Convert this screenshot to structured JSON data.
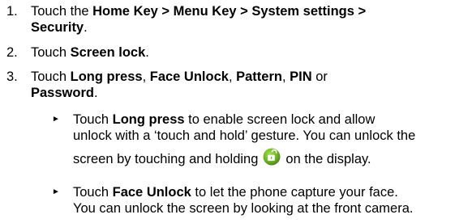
{
  "steps": [
    {
      "number": "1.",
      "lines": [
        {
          "pre": "Touch the ",
          "bold": "Home Key > Menu Key > System settings >"
        },
        {
          "bold": "Security",
          "post": "."
        }
      ]
    },
    {
      "number": "2.",
      "pre": "Touch ",
      "bold": "Screen lock",
      "post": "."
    },
    {
      "number": "3.",
      "line1": {
        "pre": "Touch ",
        "b1": "Long press",
        "s1": ", ",
        "b2": "Face Unlock",
        "s2": ", ",
        "b3": "Pattern",
        "s3": ", ",
        "b4": "PIN",
        "s4": " or"
      },
      "line2": {
        "bold": "Password",
        "post": "."
      }
    }
  ],
  "bullets": [
    {
      "marker": "►",
      "line1_pre": "Touch ",
      "line1_bold": "Long press",
      "line1_post": " to enable screen lock and allow",
      "line2": "unlock with a ‘touch and hold’ gesture. You can unlock the",
      "line3_pre": "screen by touching and holding",
      "icon": "green-unlock-icon",
      "line3_post": "on the display."
    },
    {
      "marker": "►",
      "line1_pre": "Touch ",
      "line1_bold": "Face Unlock",
      "line1_post": " to let the phone capture your face.",
      "line2": "You can unlock the screen by looking at the front camera."
    }
  ],
  "colors": {
    "text": "#000000",
    "icon_green": "#6ab023"
  }
}
